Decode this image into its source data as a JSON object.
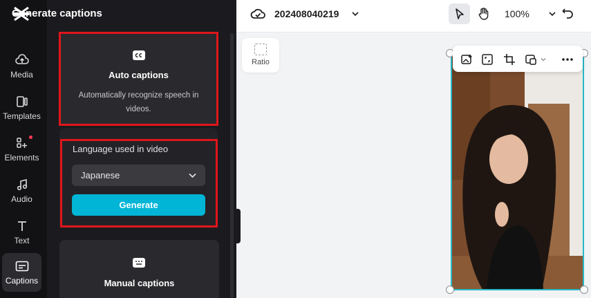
{
  "sidebar": {
    "items": [
      {
        "label": "Media",
        "icon": "media-cloud-icon"
      },
      {
        "label": "Templates",
        "icon": "templates-icon"
      },
      {
        "label": "Elements",
        "icon": "elements-icon"
      },
      {
        "label": "Audio",
        "icon": "music-note-icon"
      },
      {
        "label": "Text",
        "icon": "text-icon"
      },
      {
        "label": "Captions",
        "icon": "captions-icon",
        "active": true
      }
    ]
  },
  "panel": {
    "title": "Generate captions",
    "auto": {
      "title": "Auto captions",
      "description": "Automatically recognize speech in videos."
    },
    "language": {
      "label": "Language used in video",
      "selected": "Japanese",
      "button": "Generate"
    },
    "manual": {
      "title": "Manual captions"
    }
  },
  "topbar": {
    "project_name": "202408040219",
    "zoom": "100%"
  },
  "canvas": {
    "ratio_label": "Ratio"
  },
  "colors": {
    "accent": "#00b5d6",
    "highlight": "#e0161b",
    "selection": "#26b9c8"
  }
}
